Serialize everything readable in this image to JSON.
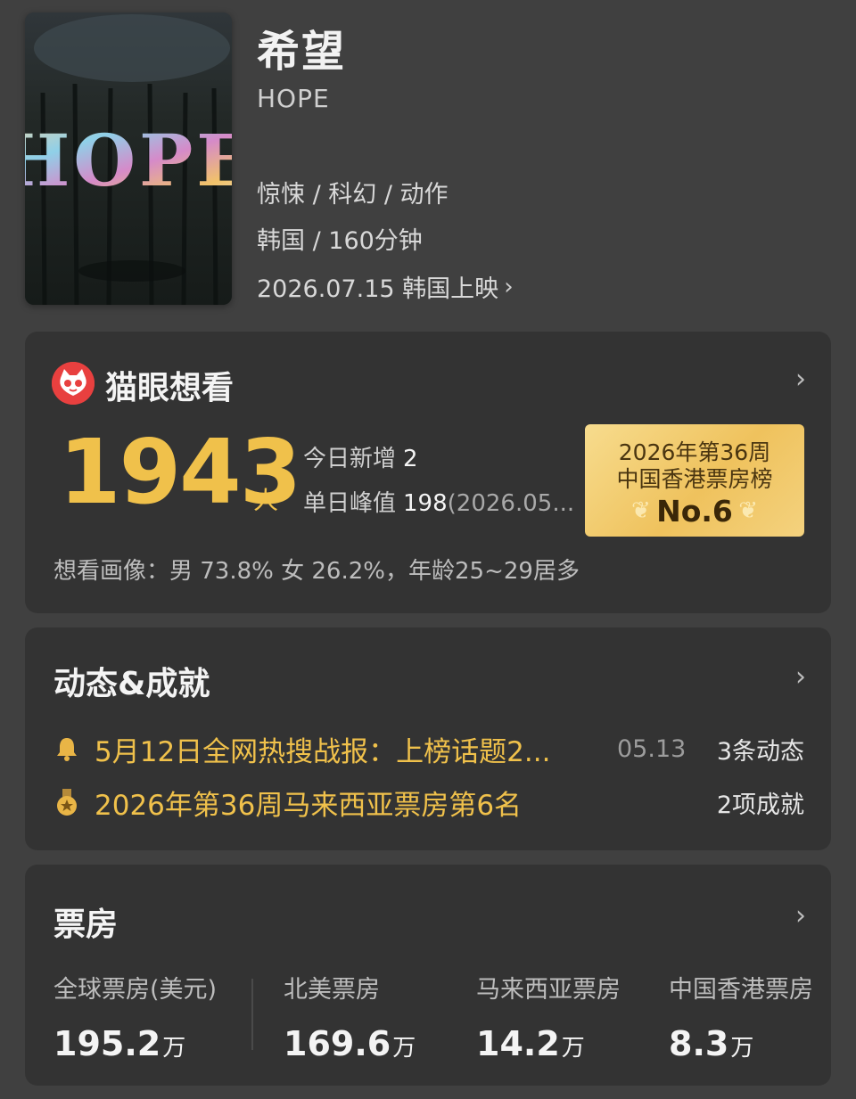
{
  "movie": {
    "title": "希望",
    "subtitle": "HOPE",
    "genres": "惊悚 / 科幻 / 动作",
    "region_duration": "韩国 / 160分钟",
    "release": "2026.07.15 韩国上映",
    "poster_text": "HOPE"
  },
  "wish": {
    "title": "猫眼想看",
    "count": "1943",
    "unit": "人",
    "today_label": "今日新增",
    "today_value": "2",
    "peak_label": "单日峰值",
    "peak_value": "198",
    "peak_date": "(2026.05...",
    "badge_line1": "2026年第36周",
    "badge_line2": "中国香港票房榜",
    "badge_rank": "No.6",
    "portrait": "想看画像：男 73.8%  女 26.2%，年龄25~29居多"
  },
  "news": {
    "title": "动态&成就",
    "item1_text": "5月12日全网热搜战报：上榜话题2...",
    "item1_date": "05.13",
    "item1_count": "3条动态",
    "item2_text": "2026年第36周马来西亚票房第6名",
    "item2_count": "2项成就"
  },
  "boxoffice": {
    "title": "票房",
    "items": [
      {
        "label": "全球票房(美元)",
        "value": "195.2",
        "unit": "万"
      },
      {
        "label": "北美票房",
        "value": "169.6",
        "unit": "万"
      },
      {
        "label": "马来西亚票房",
        "value": "14.2",
        "unit": "万"
      },
      {
        "label": "中国香港票房",
        "value": "8.3",
        "unit": "万"
      }
    ]
  },
  "icons": {
    "maoyan": "cat-logo-icon",
    "bell": "bell-icon",
    "medal": "medal-icon",
    "chevron": "chevron-right-icon"
  },
  "colors": {
    "accent": "#f0c14b",
    "background": "#404040",
    "card": "#333333",
    "maoyan_red": "#e8403f"
  }
}
